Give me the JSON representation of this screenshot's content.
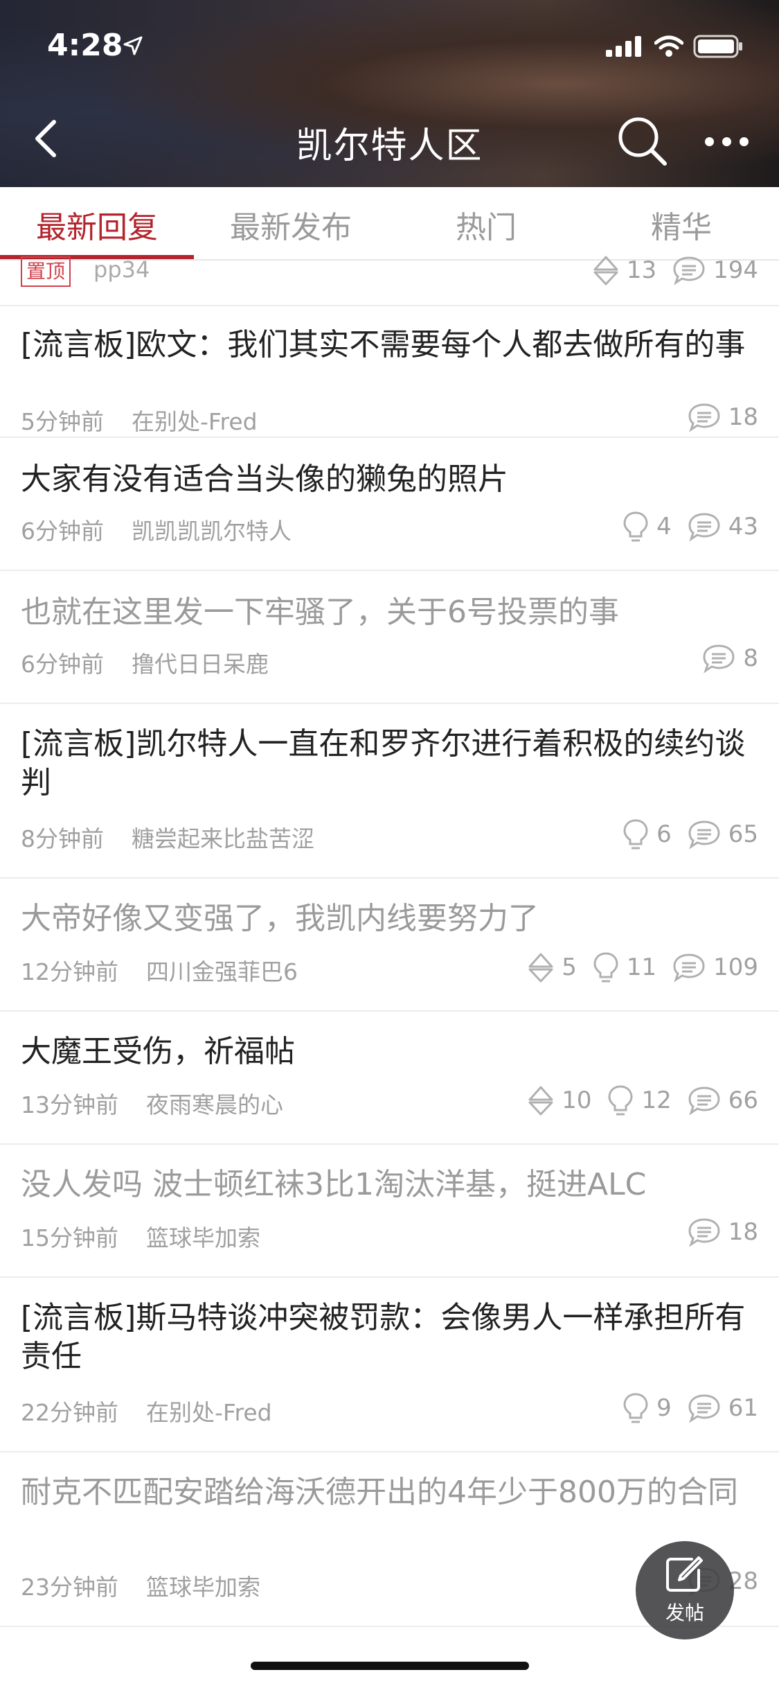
{
  "status_bar": {
    "time": "4:28"
  },
  "nav": {
    "title": "凯尔特人区"
  },
  "tabs": [
    {
      "label": "最新回复",
      "active": true
    },
    {
      "label": "最新发布",
      "active": false
    },
    {
      "label": "热门",
      "active": false
    },
    {
      "label": "精华",
      "active": false
    }
  ],
  "pinned": {
    "badge": "置顶",
    "author": "pp34",
    "likes": "13",
    "comments": "194"
  },
  "posts": [
    {
      "title": "[流言板]欧文：我们其实不需要每个人都去做所有的事",
      "time": "5分钟前",
      "author": "在别处-Fred",
      "comments": "18"
    },
    {
      "title": "大家有没有适合当头像的獭兔的照片",
      "time": "6分钟前",
      "author": "凯凯凯凯尔特人",
      "lights": "4",
      "comments": "43"
    },
    {
      "title": "也就在这里发一下牢骚了，关于6号投票的事",
      "time": "6分钟前",
      "author": "撸代日日呆鹿",
      "comments": "8"
    },
    {
      "title": "[流言板]凯尔特人一直在和罗齐尔进行着积极的续约谈判",
      "time": "8分钟前",
      "author": "糖尝起来比盐苦涩",
      "lights": "6",
      "comments": "65"
    },
    {
      "title": "大帝好像又变强了，我凯内线要努力了",
      "time": "12分钟前",
      "author": "四川金强菲巴6",
      "likes": "5",
      "lights": "11",
      "comments": "109"
    },
    {
      "title": "大魔王受伤，祈福帖",
      "time": "13分钟前",
      "author": "夜雨寒晨的心",
      "likes": "10",
      "lights": "12",
      "comments": "66"
    },
    {
      "title": "没人发吗  波士顿红袜3比1淘汰洋基，挺进ALC",
      "time": "15分钟前",
      "author": "篮球毕加索",
      "comments": "18"
    },
    {
      "title": "[流言板]斯马特谈冲突被罚款：会像男人一样承担所有责任",
      "time": "22分钟前",
      "author": "在别处-Fred",
      "lights": "9",
      "comments": "61"
    },
    {
      "title": "耐克不匹配安踏给海沃德开出的4年少于800万的合同",
      "time": "23分钟前",
      "author": "篮球毕加索",
      "comments": "28"
    }
  ],
  "fab": {
    "label": "发帖"
  },
  "colors": {
    "accent": "#b3242c",
    "read_text": "#9a9a9a",
    "meta": "#a0a0a0"
  }
}
